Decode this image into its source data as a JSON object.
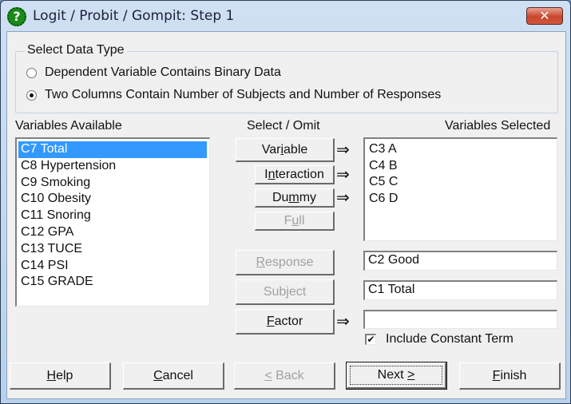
{
  "window": {
    "title": "Logit / Probit / Gompit: Step 1",
    "app_icon": "help-question-icon",
    "close_icon": "close-icon"
  },
  "data_type": {
    "group_title": "Select Data Type",
    "options": [
      {
        "label": "Dependent Variable Contains Binary Data",
        "selected": false
      },
      {
        "label": "Two Columns Contain Number of Subjects and Number of Responses",
        "selected": true
      }
    ]
  },
  "variables_available": {
    "label": "Variables Available",
    "items": [
      "C7 Total",
      "C8 Hypertension",
      "C9 Smoking",
      "C10 Obesity",
      "C11 Snoring",
      "C12 GPA",
      "C13 TUCE",
      "C14 PSI",
      "C15 GRADE"
    ],
    "selected_index": 0
  },
  "select_omit": {
    "label": "Select / Omit",
    "variable": {
      "label": "Variable",
      "mnemonic": "i",
      "enabled": true
    },
    "interaction": {
      "label": "Interaction",
      "mnemonic": "n",
      "enabled": true
    },
    "dummy": {
      "label": "Dummy",
      "mnemonic": "m",
      "enabled": true
    },
    "full": {
      "label": "Full",
      "mnemonic": "u",
      "enabled": false
    },
    "arrow": "⇒"
  },
  "variables_selected": {
    "label": "Variables Selected",
    "items": [
      "C3 A",
      "C4 B",
      "C5 C",
      "C6 D"
    ]
  },
  "response": {
    "button_label": "Response",
    "enabled": false,
    "value": "C2 Good"
  },
  "subject": {
    "button_label": "Subject",
    "enabled": false,
    "value": "C1 Total"
  },
  "factor": {
    "button_label": "Factor",
    "enabled": true,
    "value": ""
  },
  "include_constant": {
    "label": "Include Constant Term",
    "checked": true,
    "check_glyph": "✔"
  },
  "footer": {
    "help": "Help",
    "cancel": "Cancel",
    "back": "< Back",
    "next": "Next >",
    "finish": "Finish"
  }
}
